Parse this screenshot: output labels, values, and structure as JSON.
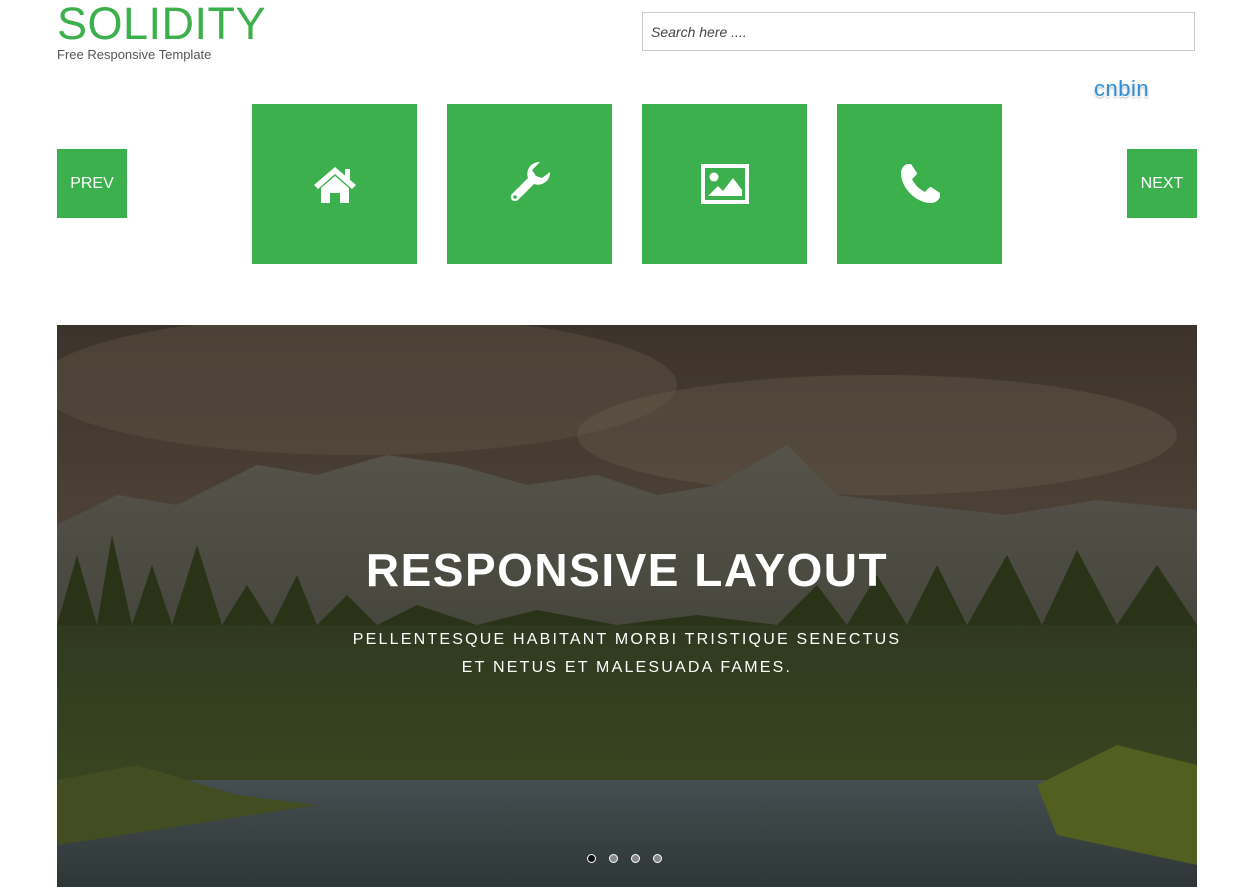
{
  "brand": {
    "title": "SOLIDITY",
    "subtitle": "Free Responsive Template"
  },
  "search": {
    "placeholder": "Search here ...."
  },
  "watermark": "cnbin",
  "carousel_nav": {
    "prev_label": "PREV",
    "next_label": "NEXT"
  },
  "tiles": [
    {
      "icon": "home-icon"
    },
    {
      "icon": "wrench-icon"
    },
    {
      "icon": "image-icon"
    },
    {
      "icon": "phone-icon"
    }
  ],
  "hero": {
    "title": "RESPONSIVE LAYOUT",
    "text_line1": "PELLENTESQUE HABITANT MORBI TRISTIQUE SENECTUS",
    "text_line2": "ET NETUS ET MALESUADA FAMES.",
    "slides": 4,
    "active_slide": 1
  },
  "colors": {
    "accent": "#3cb04c",
    "text_muted": "#555555"
  }
}
